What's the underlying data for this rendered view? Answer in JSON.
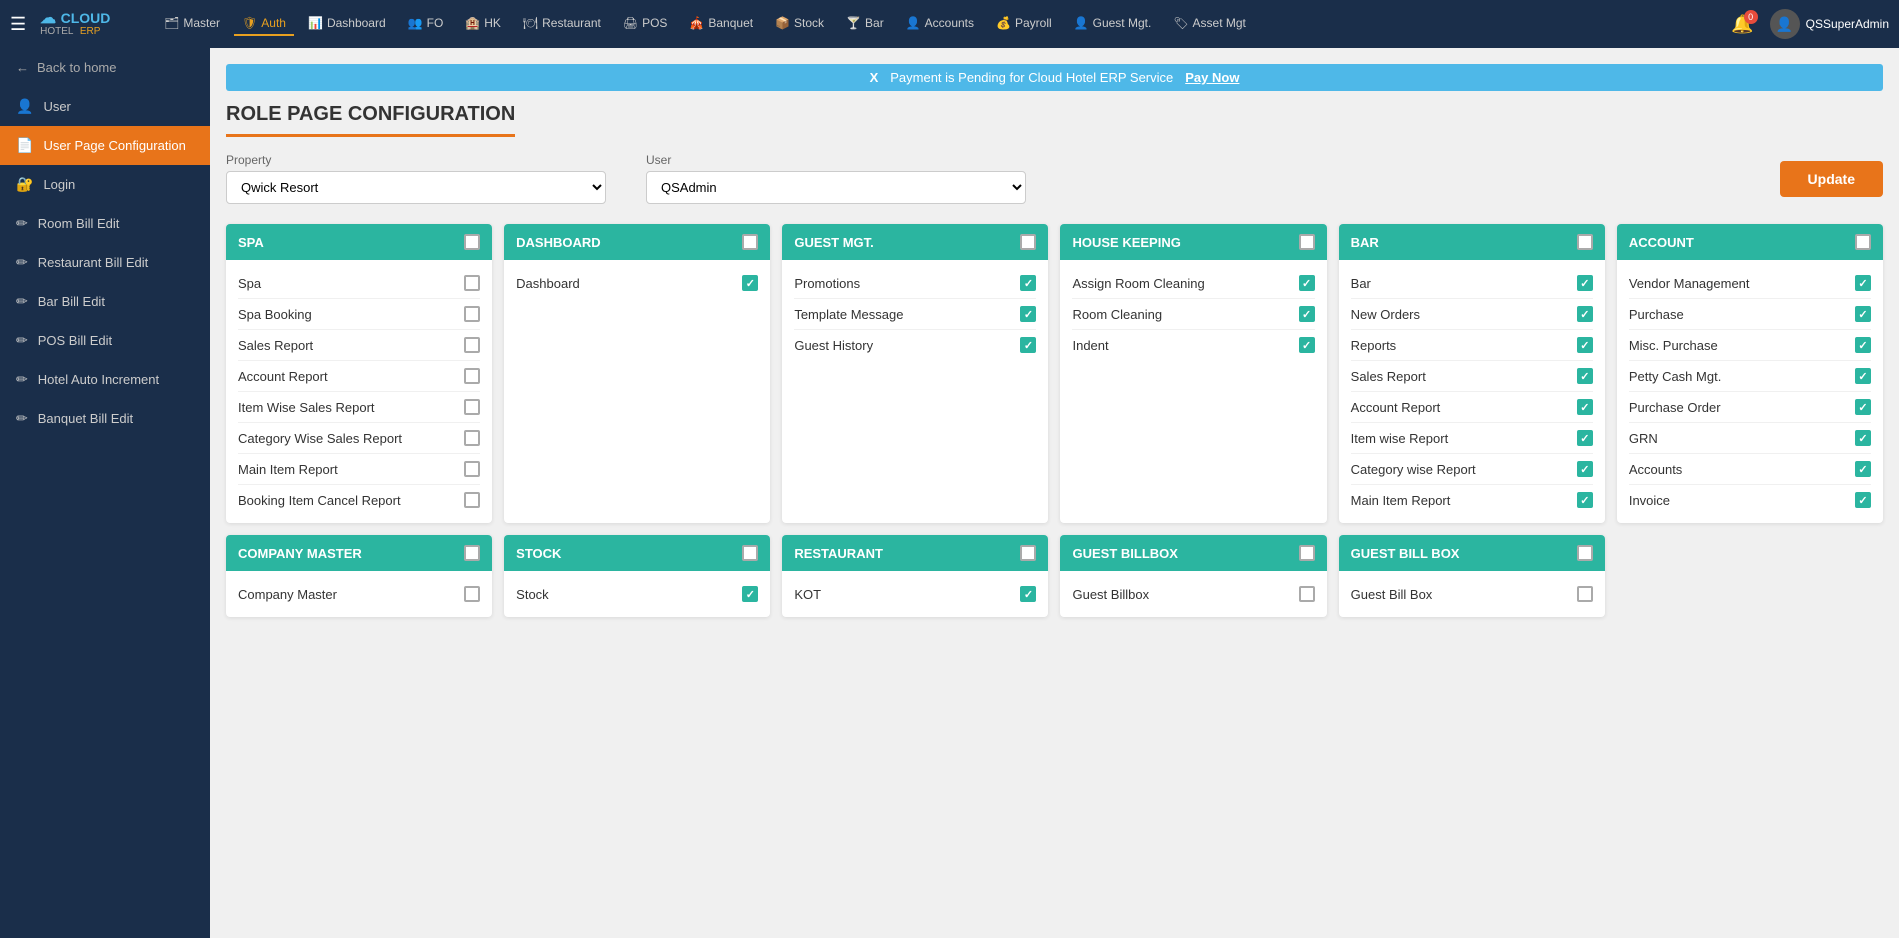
{
  "topnav": {
    "logo_cloud": "CLOUD",
    "logo_hotel": "HOTEL",
    "logo_erp": "ERP",
    "hamburger": "☰",
    "items": [
      {
        "label": "Master",
        "icon": "🗂",
        "active": false
      },
      {
        "label": "Auth",
        "icon": "🛡",
        "active": true
      },
      {
        "label": "Dashboard",
        "icon": "📊",
        "active": false
      },
      {
        "label": "FO",
        "icon": "👥",
        "active": false
      },
      {
        "label": "HK",
        "icon": "🏨",
        "active": false
      },
      {
        "label": "Restaurant",
        "icon": "🍽",
        "active": false
      },
      {
        "label": "POS",
        "icon": "🖨",
        "active": false
      },
      {
        "label": "Banquet",
        "icon": "🎪",
        "active": false
      },
      {
        "label": "Stock",
        "icon": "📦",
        "active": false
      },
      {
        "label": "Bar",
        "icon": "🍸",
        "active": false
      },
      {
        "label": "Accounts",
        "icon": "👤",
        "active": false
      },
      {
        "label": "Payroll",
        "icon": "💰",
        "active": false
      },
      {
        "label": "Guest Mgt.",
        "icon": "👤",
        "active": false
      },
      {
        "label": "Asset Mgt",
        "icon": "🏷",
        "active": false
      }
    ],
    "bell_count": "0",
    "user_name": "QSSuperAdmin"
  },
  "sidebar": {
    "back_label": "Back to home",
    "items": [
      {
        "label": "User",
        "icon": "👤",
        "active": false
      },
      {
        "label": "User Page Configuration",
        "icon": "📄",
        "active": true
      },
      {
        "label": "Login",
        "icon": "🔐",
        "active": false
      },
      {
        "label": "Room Bill Edit",
        "icon": "✏",
        "active": false
      },
      {
        "label": "Restaurant Bill Edit",
        "icon": "✏",
        "active": false
      },
      {
        "label": "Bar Bill Edit",
        "icon": "✏",
        "active": false
      },
      {
        "label": "POS Bill Edit",
        "icon": "✏",
        "active": false
      },
      {
        "label": "Hotel Auto Increment",
        "icon": "✏",
        "active": false
      },
      {
        "label": "Banquet Bill Edit",
        "icon": "✏",
        "active": false
      }
    ]
  },
  "payment_banner": {
    "message": "Payment is Pending for Cloud Hotel ERP Service",
    "pay_now": "Pay Now",
    "close": "X"
  },
  "page": {
    "title": "ROLE PAGE CONFIGURATION"
  },
  "filters": {
    "property_label": "Property",
    "property_value": "Qwick Resort",
    "property_options": [
      "Qwick Resort"
    ],
    "user_label": "User",
    "user_value": "QSAdmin",
    "user_options": [
      "QSAdmin"
    ],
    "update_label": "Update"
  },
  "cards": [
    {
      "title": "SPA",
      "header_checked": false,
      "items": [
        {
          "label": "Spa",
          "checked": false
        },
        {
          "label": "Spa Booking",
          "checked": false
        },
        {
          "label": "Sales Report",
          "checked": false
        },
        {
          "label": "Account Report",
          "checked": false
        },
        {
          "label": "Item Wise Sales Report",
          "checked": false
        },
        {
          "label": "Category Wise Sales Report",
          "checked": false
        },
        {
          "label": "Main Item Report",
          "checked": false
        },
        {
          "label": "Booking Item Cancel Report",
          "checked": false
        }
      ]
    },
    {
      "title": "DASHBOARD",
      "header_checked": false,
      "items": [
        {
          "label": "Dashboard",
          "checked": true
        }
      ]
    },
    {
      "title": "GUEST MGT.",
      "header_checked": false,
      "items": [
        {
          "label": "Promotions",
          "checked": true
        },
        {
          "label": "Template Message",
          "checked": true
        },
        {
          "label": "Guest History",
          "checked": true
        }
      ]
    },
    {
      "title": "HOUSE KEEPING",
      "header_checked": false,
      "items": [
        {
          "label": "Assign Room Cleaning",
          "checked": true
        },
        {
          "label": "Room Cleaning",
          "checked": true
        },
        {
          "label": "Indent",
          "checked": true
        }
      ]
    },
    {
      "title": "BAR",
      "header_checked": false,
      "items": [
        {
          "label": "Bar",
          "checked": true
        },
        {
          "label": "New Orders",
          "checked": true
        },
        {
          "label": "Reports",
          "checked": true
        },
        {
          "label": "Sales Report",
          "checked": true
        },
        {
          "label": "Account Report",
          "checked": true
        },
        {
          "label": "Item wise Report",
          "checked": true
        },
        {
          "label": "Category wise Report",
          "checked": true
        },
        {
          "label": "Main Item Report",
          "checked": true
        }
      ]
    },
    {
      "title": "ACCOUNT",
      "header_checked": false,
      "items": [
        {
          "label": "Vendor Management",
          "checked": true
        },
        {
          "label": "Purchase",
          "checked": true
        },
        {
          "label": "Misc. Purchase",
          "checked": true
        },
        {
          "label": "Petty Cash Mgt.",
          "checked": true
        },
        {
          "label": "Purchase Order",
          "checked": true
        },
        {
          "label": "GRN",
          "checked": true
        },
        {
          "label": "Accounts",
          "checked": true
        },
        {
          "label": "Invoice",
          "checked": true
        }
      ]
    }
  ],
  "bottom_cards": [
    {
      "title": "COMPANY MASTER",
      "header_checked": false,
      "items": [
        {
          "label": "Company Master",
          "checked": false
        }
      ]
    },
    {
      "title": "STOCK",
      "header_checked": false,
      "items": [
        {
          "label": "Stock",
          "checked": true
        }
      ]
    },
    {
      "title": "RESTAURANT",
      "header_checked": false,
      "items": [
        {
          "label": "KOT",
          "checked": true
        }
      ]
    },
    {
      "title": "GUEST BILLBOX",
      "header_checked": false,
      "items": [
        {
          "label": "Guest Billbox",
          "checked": false
        }
      ]
    },
    {
      "title": "GUEST BILL BOX",
      "header_checked": false,
      "items": [
        {
          "label": "Guest Bill Box",
          "checked": false
        }
      ]
    }
  ]
}
